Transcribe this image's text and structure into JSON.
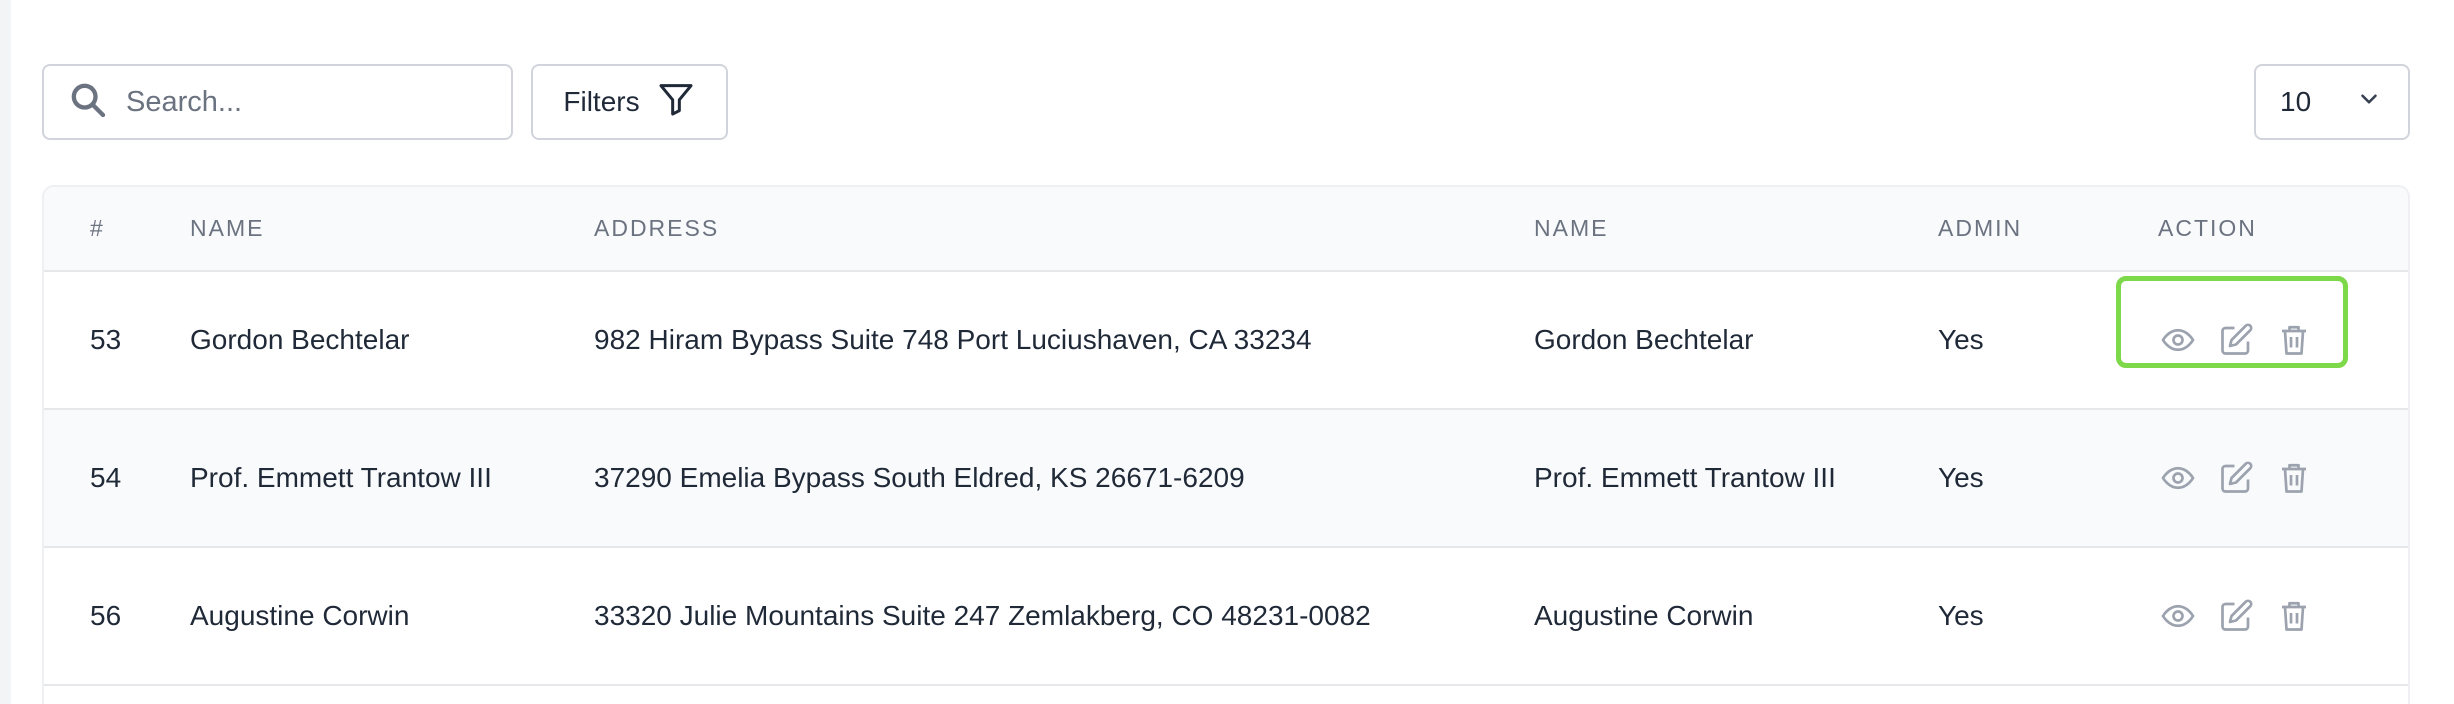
{
  "toolbar": {
    "search_placeholder": "Search...",
    "search_value": "",
    "filters_label": "Filters",
    "per_page_value": "10"
  },
  "table": {
    "headers": [
      "#",
      "NAME",
      "ADDRESS",
      "NAME",
      "ADMIN",
      "ACTION"
    ],
    "rows": [
      {
        "id": "53",
        "name": "Gordon Bechtelar",
        "address": "982 Hiram Bypass Suite 748 Port Luciushaven, CA 33234",
        "name2": "Gordon Bechtelar",
        "admin": "Yes",
        "highlighted": true
      },
      {
        "id": "54",
        "name": "Prof. Emmett Trantow III",
        "address": "37290 Emelia Bypass South Eldred, KS 26671-6209",
        "name2": "Prof. Emmett Trantow III",
        "admin": "Yes",
        "highlighted": false
      },
      {
        "id": "56",
        "name": "Augustine Corwin",
        "address": "33320 Julie Mountains Suite 247 Zemlakberg, CO 48231-0082",
        "name2": "Augustine Corwin",
        "admin": "Yes",
        "highlighted": false
      }
    ],
    "row_actions": [
      "eye-icon",
      "edit-icon",
      "trash-icon"
    ]
  },
  "colors": {
    "icon_gray": "#9ca3af",
    "highlight_green": "#7ed94a",
    "border": "#d1d5db"
  }
}
